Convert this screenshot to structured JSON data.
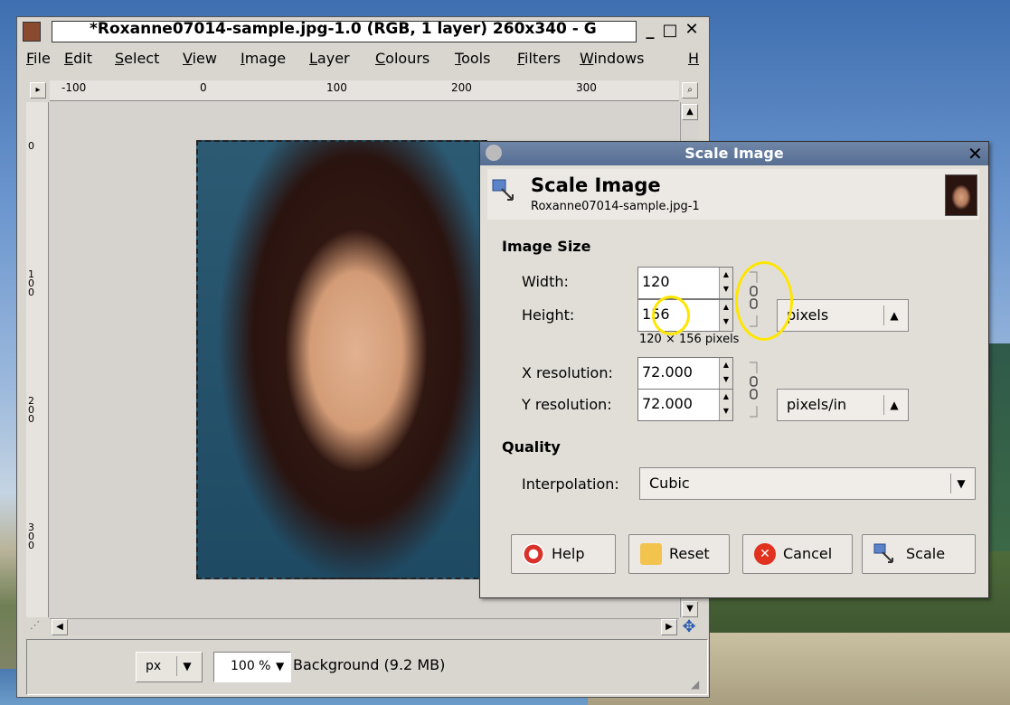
{
  "image_window": {
    "title": "*Roxanne07014-sample.jpg-1.0 (RGB, 1 layer) 260x340 - G",
    "menu": [
      "File",
      "Edit",
      "Select",
      "View",
      "Image",
      "Layer",
      "Colours",
      "Tools",
      "Filters",
      "Windows",
      "H"
    ],
    "ruler_h_labels": [
      "-100",
      "0",
      "100",
      "200",
      "300"
    ],
    "ruler_v_labels": [
      "0",
      "100",
      "200",
      "300"
    ],
    "status": {
      "unit": "px",
      "zoom": "100 %",
      "text": "Background (9.2 MB)"
    }
  },
  "dialog": {
    "window_title": "Scale Image",
    "heading": "Scale Image",
    "subtitle": "Roxanne07014-sample.jpg-1",
    "image_size": {
      "section_label": "Image Size",
      "width_label": "Width:",
      "width_value": "120",
      "height_label": "Height:",
      "height_value": "156",
      "size_unit": "pixels",
      "size_summary": "120 × 156 pixels",
      "x_res_label": "X resolution:",
      "x_res_value": "72.000",
      "y_res_label": "Y resolution:",
      "y_res_value": "72.000",
      "res_unit": "pixels/in"
    },
    "quality": {
      "section_label": "Quality",
      "interp_label": "Interpolation:",
      "interp_value": "Cubic"
    },
    "buttons": {
      "help": "Help",
      "reset": "Reset",
      "cancel": "Cancel",
      "scale": "Scale"
    }
  },
  "colors": {
    "titlebar": "#566e92",
    "highlight": "#ffe600",
    "cancel_icon": "#e0321e"
  }
}
